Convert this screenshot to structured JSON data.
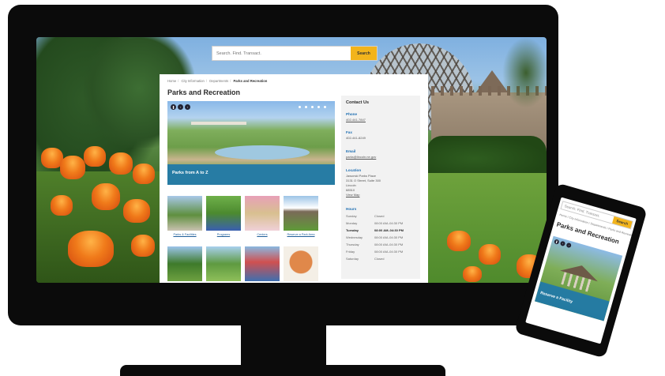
{
  "colors": {
    "accent": "#f2b41c",
    "link": "#1f6fb2",
    "caption_bg": "#1f78aa",
    "frame": "#0b0b0b"
  },
  "desktop": {
    "search": {
      "placeholder": "Search. Find. Transact.",
      "button": "Search"
    },
    "breadcrumb": [
      "Home",
      "City Information",
      "Departments",
      "Parks and Recreation"
    ],
    "page_title": "Parks and Recreation",
    "hero": {
      "caption": "Parks from A to Z",
      "controls": [
        "pause-icon",
        "prev-icon",
        "next-icon"
      ]
    },
    "tiles": [
      {
        "label": "Parks & Facilities"
      },
      {
        "label": "Programs"
      },
      {
        "label": "Centers"
      },
      {
        "label": "Reserve a Park Area"
      },
      {
        "label": ""
      },
      {
        "label": ""
      },
      {
        "label": ""
      },
      {
        "label": ""
      }
    ],
    "contact": {
      "title": "Contact Us",
      "phone_label": "Phone",
      "phone": "402-441-7847",
      "fax_label": "Fax",
      "fax": "402-441-8249",
      "email_label": "Email",
      "email": "parks@lincoln.ne.gov",
      "location_label": "Location",
      "location_lines": [
        "Jaworski Parks Place",
        "3131 O Street, Suite 300",
        "Lincoln",
        "68510"
      ],
      "map_link": "View Map",
      "hours_label": "Hours",
      "hours": [
        {
          "day": "Sunday",
          "time": "Closed"
        },
        {
          "day": "Monday",
          "time": "08:00 AM–04:30 PM"
        },
        {
          "day": "Tuesday",
          "time": "08:00 AM–04:30 PM"
        },
        {
          "day": "Wednesday",
          "time": "08:00 AM–04:30 PM"
        },
        {
          "day": "Thursday",
          "time": "08:00 AM–04:30 PM"
        },
        {
          "day": "Friday",
          "time": "08:00 AM–04:30 PM"
        },
        {
          "day": "Saturday",
          "time": "Closed"
        }
      ],
      "today": "Tuesday"
    }
  },
  "mobile": {
    "search": {
      "placeholder": "Search. Find. Transact.",
      "button": "Search"
    },
    "breadcrumb": "Home / City Information / Departments / Parks and Recreation",
    "page_title": "Parks and Recreation",
    "hero_caption": "Reserve a Facility"
  }
}
